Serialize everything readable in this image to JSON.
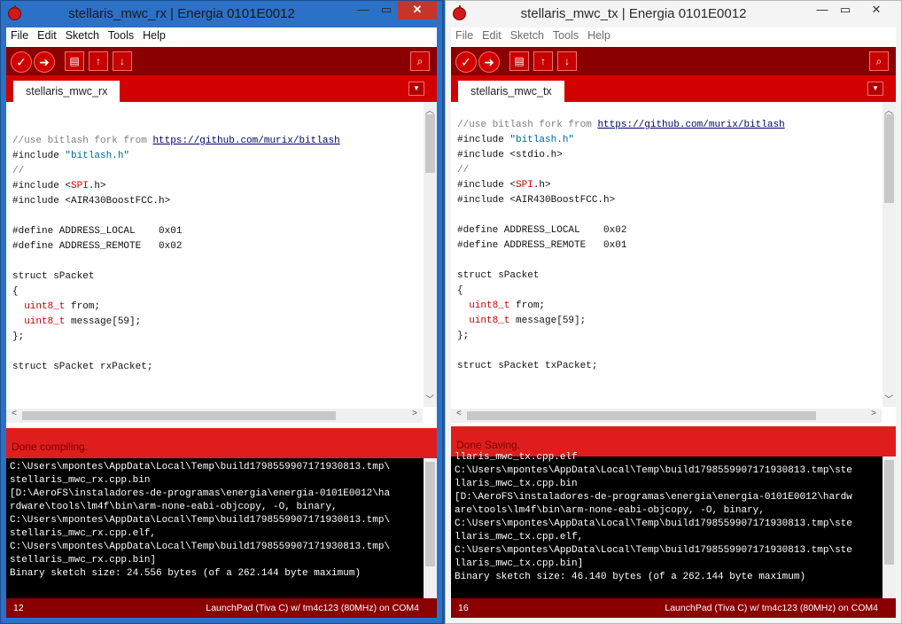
{
  "left": {
    "title": "stellaris_mwc_rx | Energia 0101E0012",
    "menu": [
      "File",
      "Edit",
      "Sketch",
      "Tools",
      "Help"
    ],
    "tab": "stellaris_mwc_rx",
    "status": "Done compiling.",
    "line_number": "12",
    "board": "LaunchPad (Tiva C) w/ tm4c123 (80MHz) on COM4",
    "console": [
      "C:\\Users\\mpontes\\AppData\\Local\\Temp\\build1798559907171930813.tmp\\",
      "stellaris_mwc_rx.cpp.bin",
      "[D:\\AeroFS\\instaladores-de-programas\\energia\\energia-0101E0012\\ha",
      "rdware\\tools\\lm4f\\bin\\arm-none-eabi-objcopy, -O, binary,",
      "C:\\Users\\mpontes\\AppData\\Local\\Temp\\build1798559907171930813.tmp\\",
      "stellaris_mwc_rx.cpp.elf,",
      "C:\\Users\\mpontes\\AppData\\Local\\Temp\\build1798559907171930813.tmp\\",
      "stellaris_mwc_rx.cpp.bin]",
      "Binary sketch size: 24.556 bytes (of a 262.144 byte maximum)"
    ],
    "code": {
      "l1_comment": "//use bitlash fork from ",
      "l1_url": "https://github.com/murix/bitlash",
      "l2_a": "#include ",
      "l2_b": "\"bitlash.h\"",
      "l3": "//",
      "l4_a": "#include <",
      "l4_b": "SPI",
      "l4_c": ".h>",
      "l5": "#include <AIR430BoostFCC.h>",
      "l7": "#define ADDRESS_LOCAL    0x01",
      "l8": "#define ADDRESS_REMOTE   0x02",
      "l10": "struct sPacket",
      "l11": "{",
      "l12_a": "  ",
      "l12_b": "uint8_t",
      "l12_c": " from;",
      "l13_a": "  ",
      "l13_b": "uint8_t",
      "l13_c": " message[59];",
      "l14": "};",
      "l16": "struct sPacket rxPacket;"
    }
  },
  "right": {
    "title": "stellaris_mwc_tx | Energia 0101E0012",
    "menu": [
      "File",
      "Edit",
      "Sketch",
      "Tools",
      "Help"
    ],
    "tab": "stellaris_mwc_tx",
    "status": "Done Saving.",
    "line_number": "16",
    "board": "LaunchPad (Tiva C) w/ tm4c123 (80MHz) on COM4",
    "console": [
      "llaris_mwc_tx.cpp.elf",
      "C:\\Users\\mpontes\\AppData\\Local\\Temp\\build1798559907171930813.tmp\\ste",
      "llaris_mwc_tx.cpp.bin",
      "[D:\\AeroFS\\instaladores-de-programas\\energia\\energia-0101E0012\\hardw",
      "are\\tools\\lm4f\\bin\\arm-none-eabi-objcopy, -O, binary,",
      "C:\\Users\\mpontes\\AppData\\Local\\Temp\\build1798559907171930813.tmp\\ste",
      "llaris_mwc_tx.cpp.elf,",
      "C:\\Users\\mpontes\\AppData\\Local\\Temp\\build1798559907171930813.tmp\\ste",
      "llaris_mwc_tx.cpp.bin]",
      "Binary sketch size: 46.140 bytes (of a 262.144 byte maximum)"
    ],
    "code": {
      "l1_comment": "//use bitlash fork from ",
      "l1_url": "https://github.com/murix/bitlash",
      "l2_a": "#include ",
      "l2_b": "\"bitlash.h\"",
      "l3": "#include <stdio.h>",
      "l4": "//",
      "l5_a": "#include <",
      "l5_b": "SPI",
      "l5_c": ".h>",
      "l6": "#include <AIR430BoostFCC.h>",
      "l8": "#define ADDRESS_LOCAL    0x02",
      "l9": "#define ADDRESS_REMOTE   0x01",
      "l11": "struct sPacket",
      "l12": "{",
      "l13_a": "  ",
      "l13_b": "uint8_t",
      "l13_c": " from;",
      "l14_a": "  ",
      "l14_b": "uint8_t",
      "l14_c": " message[59];",
      "l15": "};",
      "l17": "struct sPacket txPacket;"
    }
  },
  "icons": {
    "verify": "check-icon",
    "upload": "arrow-right-icon",
    "new": "new-file-icon",
    "open": "open-up-icon",
    "save": "save-down-icon",
    "monitor": "serial-monitor-icon"
  },
  "colors": {
    "toolbar": "#8a0000",
    "tabs": "#d30000",
    "status": "#e01d1d",
    "footer": "#8a0000"
  }
}
